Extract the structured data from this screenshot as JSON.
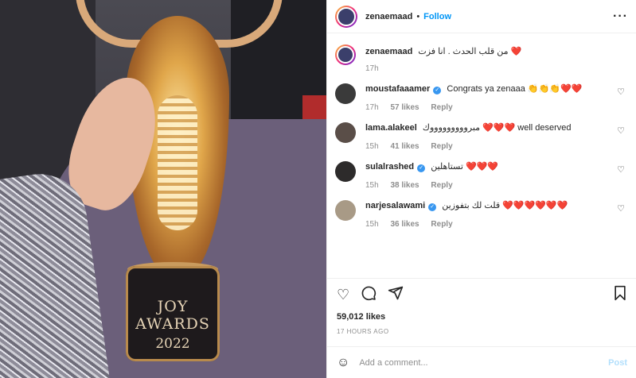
{
  "header": {
    "username": "zenaemaad",
    "separator": "•",
    "follow_label": "Follow",
    "more_icon": "more-horizontal-icon"
  },
  "caption": {
    "username": "zenaemaad",
    "text": "من قلب الحدث . انا فزت ❤️",
    "age": "17h"
  },
  "comments": [
    {
      "username": "moustafaaamer",
      "verified": true,
      "text": "Congrats ya zenaaa 👏👏👏❤️❤️",
      "age": "17h",
      "likes": "57 likes",
      "reply": "Reply"
    },
    {
      "username": "lama.alakeel",
      "verified": false,
      "text": "مبروووووووووك ❤️❤️❤️ well deserved",
      "age": "15h",
      "likes": "41 likes",
      "reply": "Reply"
    },
    {
      "username": "sulalrashed",
      "verified": true,
      "text": "تستاهلين ❤️❤️❤️",
      "age": "15h",
      "likes": "38 likes",
      "reply": "Reply"
    },
    {
      "username": "narjesalawami",
      "verified": true,
      "text": "قلت لك بتفوزين ❤️❤️❤️❤️❤️❤️",
      "age": "15h",
      "likes": "36 likes",
      "reply": "Reply"
    }
  ],
  "stats": {
    "likes": "59,012 likes",
    "time": "17 HOURS AGO"
  },
  "add_comment": {
    "placeholder": "Add a comment...",
    "post_label": "Post"
  },
  "photo": {
    "trophy_text": "JOY AWARDS",
    "trophy_year": "2022"
  },
  "colors": {
    "follow": "#0095f6",
    "heart": "#ed4956",
    "post_disabled": "#b2dffc"
  }
}
